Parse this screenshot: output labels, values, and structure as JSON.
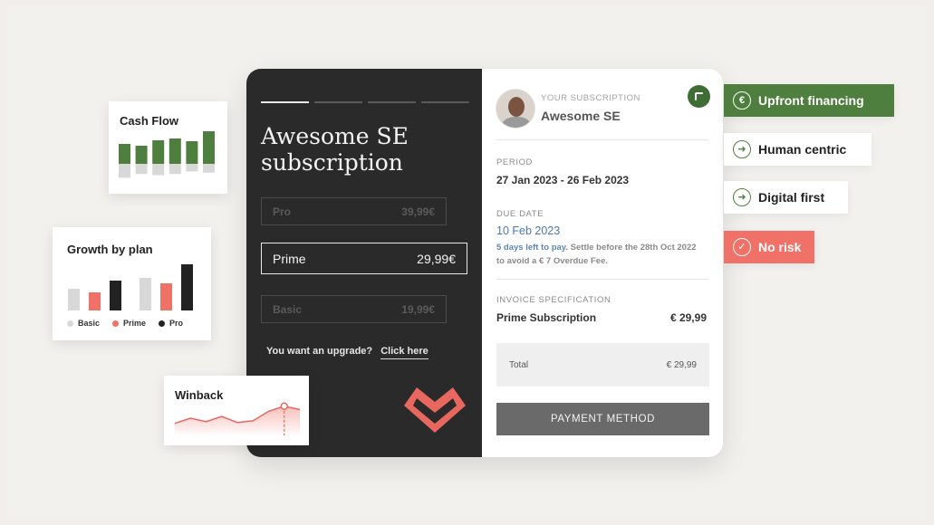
{
  "colors": {
    "background": "#f1eeeb",
    "dark_panel": "#2a2a2a",
    "green": "#4f7f3f",
    "coral": "#f07167",
    "link_blue": "#4c78a8"
  },
  "main": {
    "title": "Awesome SE subscription",
    "plans": [
      {
        "name": "Pro",
        "price": "39,99€",
        "selected": false
      },
      {
        "name": "Prime",
        "price": "29,99€",
        "selected": true
      },
      {
        "name": "Basic",
        "price": "19,99€",
        "selected": false
      }
    ],
    "upgrade_text": "You want an upgrade?",
    "upgrade_link": "Click here"
  },
  "subscription": {
    "label": "YOUR SUBSCRIPTION",
    "name": "Awesome SE",
    "period_label": "PERIOD",
    "period_value": "27 Jan 2023 - 26 Feb 2023",
    "due_label": "DUE DATE",
    "due_value": "10 Feb 2023",
    "due_note_highlight": "5 days left to pay.",
    "due_note_rest": "Settle before the 28th Oct 2022 to avoid a € 7 Overdue Fee.",
    "spec_label": "INVOICE SPECIFICATION",
    "spec_item": "Prime Subscription",
    "spec_price": "€ 29,99",
    "total_label": "Total",
    "total_value": "€ 29,99",
    "payment_button": "PAYMENT METHOD"
  },
  "badges": [
    {
      "label": "Upfront financing",
      "icon": "euro-icon"
    },
    {
      "label": "Human centric",
      "icon": "arrow-right-circle-icon"
    },
    {
      "label": "Digital first",
      "icon": "arrow-right-circle-icon"
    },
    {
      "label": "No risk",
      "icon": "check-circle-icon"
    }
  ],
  "cards": {
    "cash_flow_title": "Cash Flow",
    "growth_title": "Growth by plan",
    "winback_title": "Winback"
  },
  "chart_data": [
    {
      "type": "bar",
      "title": "Cash Flow",
      "categories": [
        "1",
        "2",
        "3",
        "4",
        "5",
        "6"
      ],
      "series": [
        {
          "values": [
            22,
            20,
            26,
            28,
            25,
            36
          ]
        },
        {
          "values": [
            -22,
            -16,
            -18,
            -16,
            -12,
            -14
          ]
        }
      ],
      "legend": "none"
    },
    {
      "type": "bar",
      "title": "Growth by plan",
      "categories": [
        "1",
        "2"
      ],
      "series": [
        {
          "name": "Basic",
          "values": [
            24,
            36
          ]
        },
        {
          "name": "Prime",
          "values": [
            20,
            30
          ]
        },
        {
          "name": "Pro",
          "values": [
            33,
            51
          ]
        }
      ],
      "legend": "bottom"
    },
    {
      "type": "area",
      "title": "Winback",
      "x": [
        0,
        1,
        2,
        3,
        4,
        5,
        6,
        7,
        8
      ],
      "values": [
        14,
        20,
        16,
        22,
        15,
        17,
        28,
        34,
        30
      ],
      "legend": "none"
    }
  ]
}
